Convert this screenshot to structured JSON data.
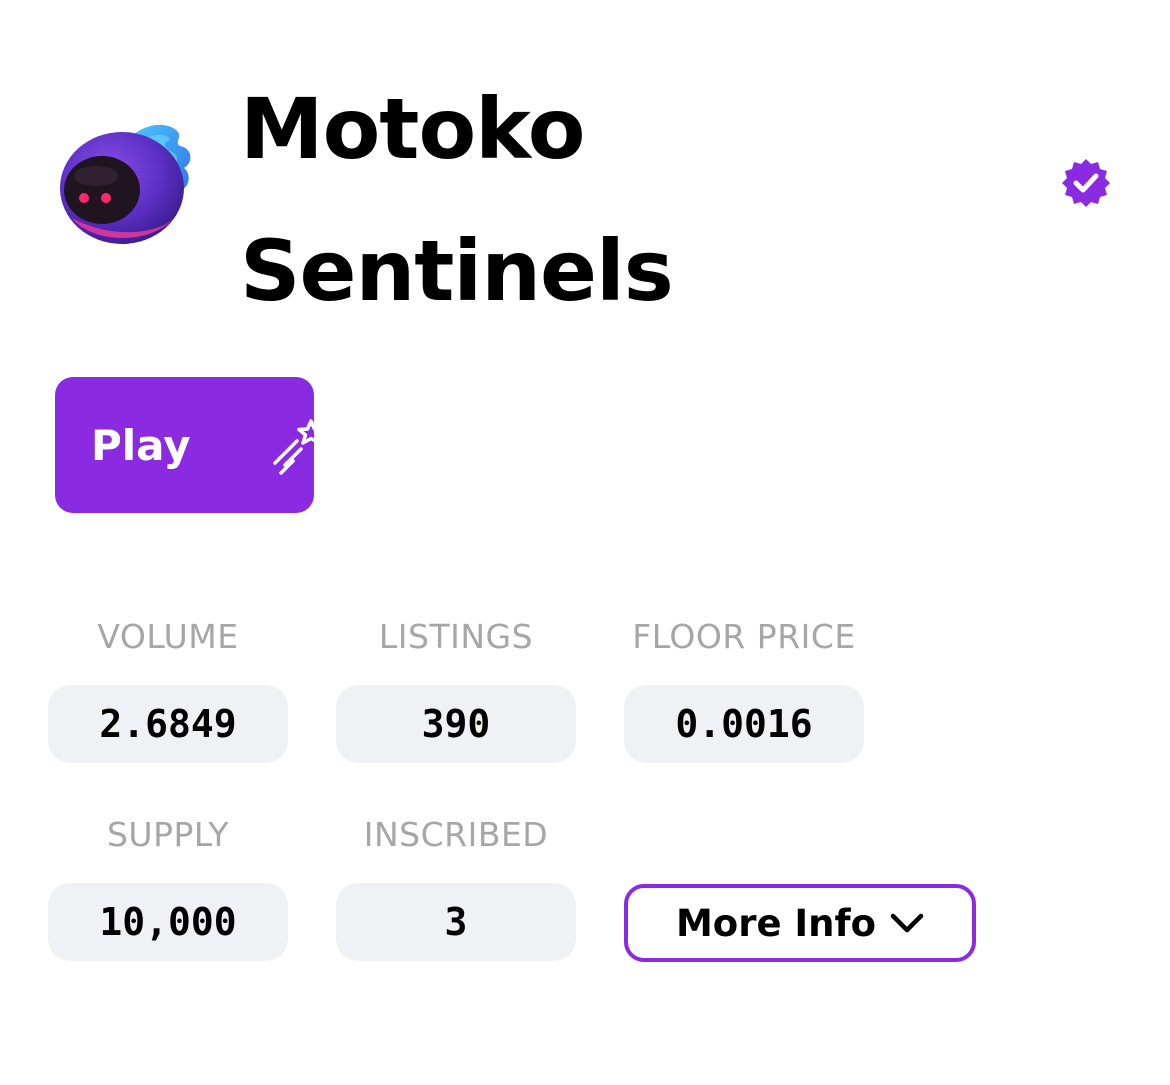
{
  "collection": {
    "title_line1": "Motoko",
    "title_line2": "Sentinels",
    "avatar_icon": "motoko-ghost-avatar",
    "verified_icon": "verified-badge-icon"
  },
  "actions": {
    "play_label": "Play",
    "play_icon": "shooting-star-icon",
    "more_info_label": "More Info",
    "more_info_icon": "chevron-down-icon"
  },
  "stats": {
    "volume": {
      "label": "VOLUME",
      "value": "2.6849"
    },
    "listings": {
      "label": "LISTINGS",
      "value": "390"
    },
    "floor_price": {
      "label": "FLOOR PRICE",
      "value": "0.0016"
    },
    "supply": {
      "label": "SUPPLY",
      "value": "10,000"
    },
    "inscribed": {
      "label": "INSCRIBED",
      "value": "3"
    }
  },
  "colors": {
    "accent": "#8a2be2",
    "stat_background": "#f0f1f5",
    "label_gray": "#a6a6a6"
  }
}
